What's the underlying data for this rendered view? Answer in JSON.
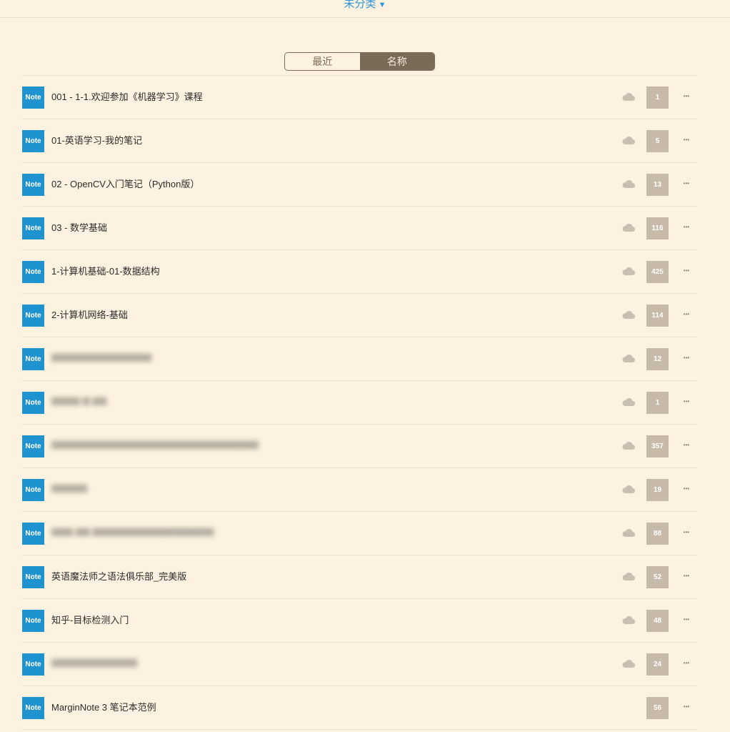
{
  "header": {
    "category_label": "未分类",
    "caret": "▼"
  },
  "sort_toggle": {
    "options": [
      {
        "label": "最近",
        "active": false
      },
      {
        "label": "名称",
        "active": true
      }
    ]
  },
  "notebooks": [
    {
      "badge": "Note",
      "title": "001 - 1-1.欢迎参加《机器学习》课程",
      "count": "1",
      "cloud": true,
      "blurred": false
    },
    {
      "badge": "Note",
      "title": "01-英语学习-我的笔记",
      "count": "5",
      "cloud": true,
      "blurred": false
    },
    {
      "badge": "Note",
      "title": "02 - OpenCV入门笔记（Python版）",
      "count": "13",
      "cloud": true,
      "blurred": false
    },
    {
      "badge": "Note",
      "title": "03 - 数学基础",
      "count": "116",
      "cloud": true,
      "blurred": false
    },
    {
      "badge": "Note",
      "title": "1-计算机基础-01-数据结构",
      "count": "425",
      "cloud": true,
      "blurred": false
    },
    {
      "badge": "Note",
      "title": "2-计算机网络-基础",
      "count": "114",
      "cloud": true,
      "blurred": false
    },
    {
      "badge": "Note",
      "title": "▆▆▆▆▆▆▆▆▆▆▆▆▆▆",
      "count": "12",
      "cloud": true,
      "blurred": true
    },
    {
      "badge": "Note",
      "title": "▆▆▆▆ ▆ ▆▆",
      "count": "1",
      "cloud": true,
      "blurred": true
    },
    {
      "badge": "Note",
      "title": "▆▆▆▆▆▆▆▆▆▆▆▆▆▆▆▆▆▆▆▆▆▆▆▆▆▆▆▆▆",
      "count": "357",
      "cloud": true,
      "blurred": true
    },
    {
      "badge": "Note",
      "title": "▆▆▆▆▆",
      "count": "19",
      "cloud": true,
      "blurred": true
    },
    {
      "badge": "Note",
      "title": "▆▆▆ ▆▆ ▆▆▆▆▆▆▆▆▆▆▆▆▆▆▆▆▆",
      "count": "88",
      "cloud": true,
      "blurred": true
    },
    {
      "badge": "Note",
      "title": "英语魔法师之语法俱乐部_完美版",
      "count": "52",
      "cloud": true,
      "blurred": false
    },
    {
      "badge": "Note",
      "title": "知乎-目标检测入门",
      "count": "48",
      "cloud": true,
      "blurred": false
    },
    {
      "badge": "Note",
      "title": "▆▆▆▆▆▆▆▆▆▆▆▆",
      "count": "24",
      "cloud": true,
      "blurred": true
    },
    {
      "badge": "Note",
      "title": "MarginNote 3 笔记本范例",
      "count": "56",
      "cloud": false,
      "blurred": false
    }
  ],
  "icons": {
    "cloud": "cloud-icon",
    "more": "more-dots-icon"
  },
  "colors": {
    "background": "#fdf2df",
    "accent": "#2d96d6",
    "badge": "#1f93d0",
    "count_bg": "#c7baa9",
    "toggle_active": "#7a6b58"
  }
}
